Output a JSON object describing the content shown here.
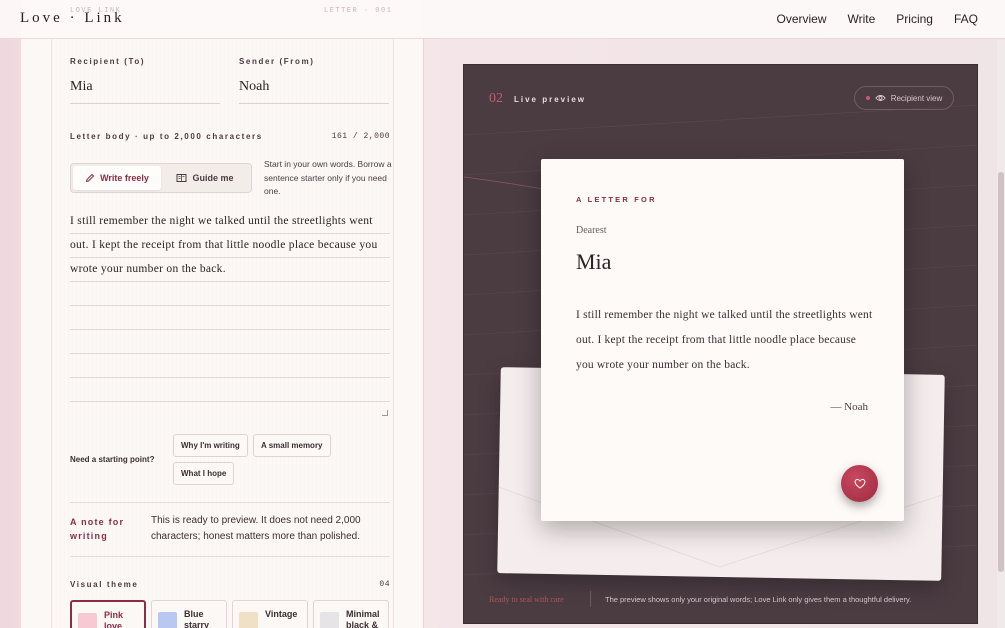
{
  "nav": {
    "brand": "Love · Link",
    "ghost_left": "LOVE LINK",
    "ghost_right": "LETTER · 001",
    "links": [
      "Overview",
      "Write",
      "Pricing",
      "FAQ"
    ]
  },
  "form": {
    "recipient_label": "Recipient (To)",
    "recipient_value": "Mia",
    "sender_label": "Sender (From)",
    "sender_value": "Noah",
    "body_label": "Letter body · up to 2,000 characters",
    "counter": "161 / 2,000",
    "modes": [
      {
        "label": "Write freely",
        "active": true,
        "icon": "pencil-icon"
      },
      {
        "label": "Guide me",
        "active": false,
        "icon": "book-icon"
      }
    ],
    "mode_hint": "Start in your own words. Borrow a sentence starter only if you need one.",
    "letter_text": "I still remember the night we talked until the streetlights went out. I kept the receipt from that little noodle place because you wrote your number on the back.",
    "starting_point_label": "Need a starting point?",
    "chips": [
      "Why I'm writing",
      "A small memory",
      "What I hope"
    ],
    "note_title": "A note for writing",
    "note_text": "This is ready to preview. It does not need 2,000 characters; honest matters more than polished.",
    "theme_label": "Visual theme",
    "theme_count": "04",
    "themes": [
      {
        "label": "Pink love",
        "color": "#f6c9d3",
        "active": true
      },
      {
        "label": "Blue starry",
        "color": "#b9c8f0",
        "active": false
      },
      {
        "label": "Vintage",
        "color": "#efe0c6",
        "active": false
      },
      {
        "label": "Minimal black &",
        "color": "#e6e4e6",
        "active": false
      }
    ]
  },
  "preview": {
    "num": "02",
    "title": "Live preview",
    "recipient_view": "Recipient view",
    "kicker": "A LETTER FOR",
    "dearest": "Dearest",
    "name": "Mia",
    "body": "I still remember the night we talked until the streetlights went out. I kept the receipt from that little noodle place because you wrote your number on the back.",
    "sign": "— Noah",
    "footer_left": "Ready to seal with care",
    "footer_right": "The preview shows only your original words; Love Link only gives them a thoughtful delivery."
  },
  "colors": {
    "accent": "#8a2e45",
    "preview_bg": "#4b3c42",
    "heart": "#b63650"
  }
}
